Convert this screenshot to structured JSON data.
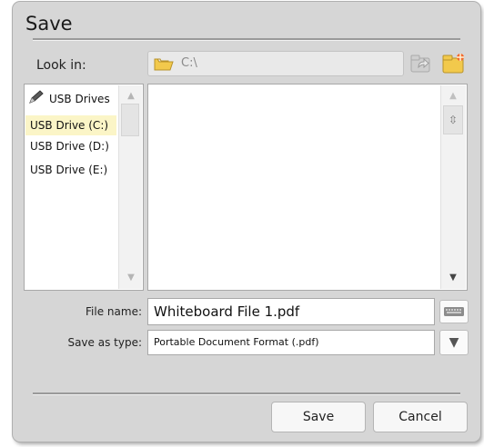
{
  "dialog": {
    "title": "Save",
    "look_in_label": "Look in:",
    "path": "C:\\"
  },
  "icons": {
    "folder": "open-folder-icon",
    "up_folder": "up-folder-icon",
    "new_folder": "new-folder-icon",
    "pen": "pen-icon",
    "keyboard": "keyboard-icon",
    "dropdown": "dropdown-arrow-icon"
  },
  "drives": {
    "header": "USB Drives",
    "items": [
      {
        "label": "USB Drive (C:)",
        "selected": true
      },
      {
        "label": "USB Drive (D:)",
        "selected": false
      },
      {
        "label": "USB Drive (E:)",
        "selected": false
      }
    ]
  },
  "form": {
    "filename_label": "File name:",
    "filename_value": "Whiteboard File 1.pdf",
    "type_label": "Save as type:",
    "type_value": "Portable Document Format (.pdf)"
  },
  "buttons": {
    "save": "Save",
    "cancel": "Cancel"
  },
  "colors": {
    "dialog_bg": "#d6d6d6",
    "selection_bg": "#fbf5c7",
    "folder_yellow": "#f2c94c"
  }
}
